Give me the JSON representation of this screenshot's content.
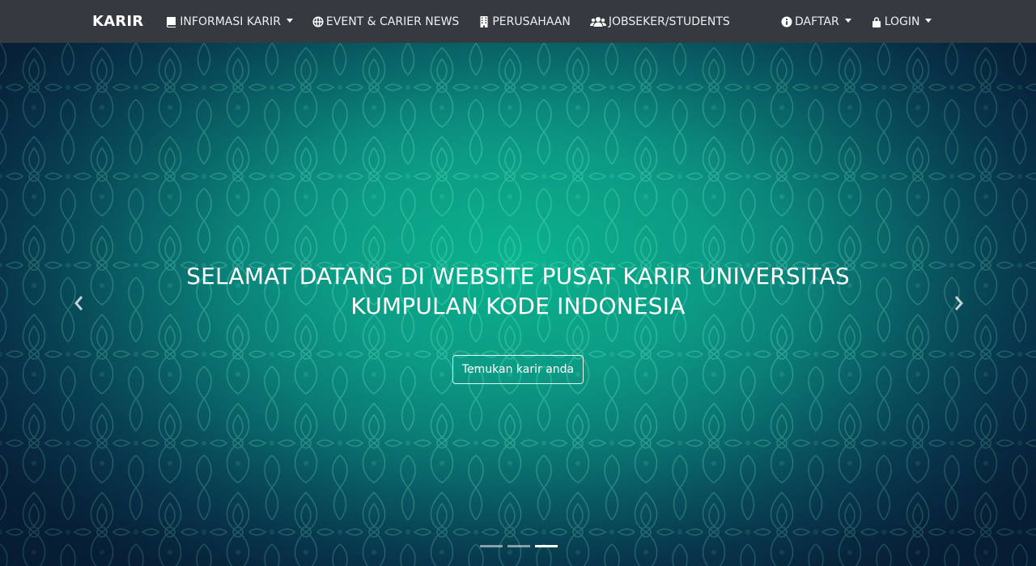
{
  "navbar": {
    "brand": "KARIR",
    "left_items": [
      {
        "label": "INFORMASI KARIR",
        "icon": "book-icon",
        "dropdown": true
      },
      {
        "label": "EVENT & CARIER NEWS",
        "icon": "globe-icon",
        "dropdown": false
      },
      {
        "label": "PERUSAHAAN",
        "icon": "building-icon",
        "dropdown": false
      },
      {
        "label": "JOBSEKER/STUDENTS",
        "icon": "users-icon",
        "dropdown": false
      }
    ],
    "right_items": [
      {
        "label": "DAFTAR",
        "icon": "info-circle-icon",
        "dropdown": true
      },
      {
        "label": "LOGIN",
        "icon": "lock-icon",
        "dropdown": true
      }
    ]
  },
  "hero": {
    "title_line1": "SELAMAT DATANG DI WEBSITE PUSAT KARIR UNIVERSITAS",
    "title_line2": "KUMPULAN KODE INDONESIA",
    "cta_label": "Temukan karir anda",
    "slide_count": 3,
    "active_slide": 3
  },
  "colors": {
    "navbar_bg": "#343a40",
    "hero_center": "#0bb38f",
    "hero_edge": "#0a2640"
  }
}
